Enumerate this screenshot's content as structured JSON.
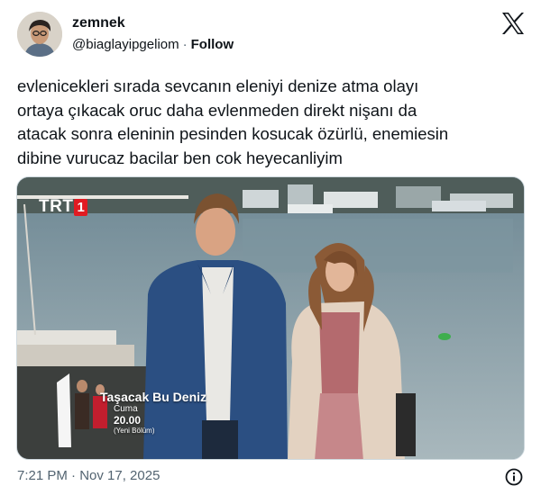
{
  "author": {
    "display_name": "zemnek",
    "handle": "@biaglayipgeliom",
    "separator": "·",
    "follow_label": "Follow"
  },
  "platform_icon": "x-logo-icon",
  "tweet": {
    "text": "evlenicekleri sırada sevcanın eleniyi denize atma olayı\nortaya çıkacak oruc daha evlenmeden direkt nişanı da\natacak sonra eleninin pesinden kosucak özürlü, enemiesin\ndibine vurucaz bacilar ben cok heyecanliyim"
  },
  "media": {
    "channel_logo_text": "TRT",
    "channel_logo_number": "1",
    "show_title": "Taşacak Bu Deniz",
    "show_day": "Cuma",
    "show_time": "20.00",
    "show_note": "(Yeni Bölüm)",
    "colors": {
      "logo_red": "#e11b22",
      "water": "#8fa5ae"
    }
  },
  "footer": {
    "timestamp": "7:21 PM · Nov 17, 2025",
    "info_icon": "info-icon"
  }
}
